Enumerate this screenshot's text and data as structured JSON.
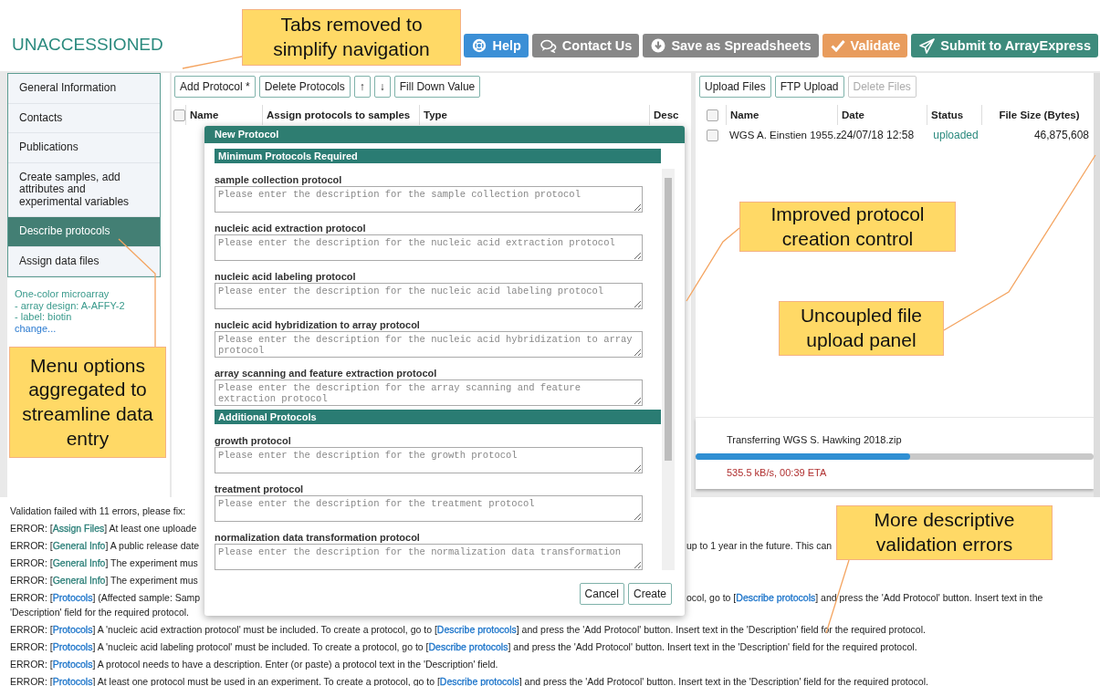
{
  "title": "UNACCESSIONED",
  "header_buttons": [
    {
      "kind": "help",
      "label": "Help"
    },
    {
      "kind": "contact",
      "label": "Contact Us"
    },
    {
      "kind": "save",
      "label": "Save as Spreadsheets"
    },
    {
      "kind": "validate",
      "label": "Validate"
    },
    {
      "kind": "submit",
      "label": "Submit to ArrayExpress"
    }
  ],
  "sidebar": {
    "items": [
      {
        "label": "General Information",
        "selected": false
      },
      {
        "label": "Contacts",
        "selected": false
      },
      {
        "label": "Publications",
        "selected": false
      },
      {
        "label": "Create samples, add attributes and experimental variables",
        "selected": false
      },
      {
        "label": "Describe protocols",
        "selected": true
      },
      {
        "label": "Assign data files",
        "selected": false
      }
    ],
    "summary": {
      "lines": [
        "One-color microarray",
        "- array design: A-AFFY-2",
        "- label: biotin"
      ],
      "link": "change..."
    }
  },
  "protocols": {
    "toolbar": [
      {
        "label": "Add Protocol *"
      },
      {
        "label": "Delete Protocols"
      },
      {
        "label": "↑"
      },
      {
        "label": "↓"
      },
      {
        "label": "Fill Down Value"
      }
    ],
    "table": {
      "header_checkbox": {
        "checked": false
      },
      "columns": [
        "Name",
        "Assign protocols to samples",
        "Type",
        "Desc"
      ]
    }
  },
  "dialog": {
    "title": "New Protocol",
    "sections": [
      {
        "title": "Minimum Protocols Required",
        "fields": [
          {
            "label": "sample collection protocol",
            "placeholder": "Please enter the description for the sample collection protocol"
          },
          {
            "label": "nucleic acid extraction protocol",
            "placeholder": "Please enter the description for the nucleic acid extraction protocol"
          },
          {
            "label": "nucleic acid labeling protocol",
            "placeholder": "Please enter the description for the nucleic acid labeling protocol"
          },
          {
            "label": "nucleic acid hybridization to array protocol",
            "placeholder": "Please enter the description for the nucleic acid hybridization to array protocol"
          },
          {
            "label": "array scanning and feature extraction protocol",
            "placeholder": "Please enter the description for the array scanning and feature extraction protocol"
          }
        ]
      },
      {
        "title": "Additional Protocols",
        "fields": [
          {
            "label": "growth protocol",
            "placeholder": "Please enter the description for the growth protocol"
          },
          {
            "label": "treatment protocol",
            "placeholder": "Please enter the description for the treatment protocol"
          },
          {
            "label": "normalization data transformation protocol",
            "placeholder": "Please enter the description for the normalization data transformation"
          }
        ]
      }
    ],
    "buttons": [
      "Cancel",
      "Create"
    ]
  },
  "files": {
    "toolbar": [
      {
        "label": "Upload Files",
        "disabled": false
      },
      {
        "label": "FTP Upload",
        "disabled": false
      },
      {
        "label": "Delete Files",
        "disabled": true
      }
    ],
    "table": {
      "header_checkbox": {
        "checked": false
      },
      "columns": [
        "Name",
        "Date",
        "Status",
        "File Size (Bytes)"
      ],
      "rows": [
        {
          "checked": false,
          "name": "WGS A. Einstien 1955.z",
          "date": "24/07/18 12:58",
          "status": "uploaded",
          "size": "46,875,608"
        }
      ]
    },
    "transfer": {
      "label": "Transferring WGS S. Hawking 2018.zip",
      "level": 0.54,
      "rate": "535.5 kB/s, 00:39 ETA"
    }
  },
  "validation": {
    "summary": "Validation failed with 11 errors, please fix:",
    "errors": [
      {
        "segments": [
          {
            "kind": "text",
            "text": "ERROR: ["
          },
          {
            "kind": "link",
            "text": "Assign Files",
            "color": "#2b7f78"
          },
          {
            "kind": "text",
            "text": "] At least one uploade"
          }
        ]
      },
      {
        "segments": [
          {
            "kind": "text",
            "text": "ERROR: ["
          },
          {
            "kind": "link",
            "text": "General Info",
            "color": "#2b7f78"
          },
          {
            "kind": "text",
            "text": "] A public release date"
          }
        ],
        "right_segments": [
          {
            "kind": "text",
            "text": "up to 1 year in the future. This can"
          }
        ]
      },
      {
        "segments": [
          {
            "kind": "text",
            "text": "ERROR: ["
          },
          {
            "kind": "link",
            "text": "General Info",
            "color": "#2b7f78"
          },
          {
            "kind": "text",
            "text": "] The experiment mus"
          }
        ]
      },
      {
        "segments": [
          {
            "kind": "text",
            "text": "ERROR: ["
          },
          {
            "kind": "link",
            "text": "General Info",
            "color": "#2b7f78"
          },
          {
            "kind": "text",
            "text": "] The experiment mus"
          }
        ]
      },
      {
        "segments": [
          {
            "kind": "text",
            "text": "ERROR: ["
          },
          {
            "kind": "link",
            "text": "Protocols",
            "color": "#1a73c9"
          },
          {
            "kind": "text",
            "text": "] (Affected sample: Samp"
          }
        ],
        "right_segments": [
          {
            "kind": "text",
            "text": "ocol, go to ["
          },
          {
            "kind": "link",
            "text": "Describe protocols",
            "color": "#1a73c9"
          },
          {
            "kind": "text",
            "text": "] and press the 'Add Protocol' button. Insert text in the"
          }
        ],
        "continuation": "'Description' field for the required protocol."
      },
      {
        "segments": [
          {
            "kind": "text",
            "text": "ERROR: ["
          },
          {
            "kind": "link",
            "text": "Protocols",
            "color": "#1a73c9"
          },
          {
            "kind": "text",
            "text": "] A 'nucleic acid extraction protocol' must be included. To create a protocol, go to ["
          },
          {
            "kind": "link",
            "text": "Describe protocols",
            "color": "#1a73c9"
          },
          {
            "kind": "text",
            "text": "] and press the 'Add Protocol' button. Insert text in the 'Description' field for the required protocol."
          }
        ]
      },
      {
        "segments": [
          {
            "kind": "text",
            "text": "ERROR: ["
          },
          {
            "kind": "link",
            "text": "Protocols",
            "color": "#1a73c9"
          },
          {
            "kind": "text",
            "text": "] A 'nucleic acid labeling protocol' must be included. To create a protocol, go to ["
          },
          {
            "kind": "link",
            "text": "Describe protocols",
            "color": "#1a73c9"
          },
          {
            "kind": "text",
            "text": "] and press the 'Add Protocol' button. Insert text in the 'Description' field for the required protocol."
          }
        ]
      },
      {
        "segments": [
          {
            "kind": "text",
            "text": "ERROR: ["
          },
          {
            "kind": "link",
            "text": "Protocols",
            "color": "#1a73c9"
          },
          {
            "kind": "text",
            "text": "] A protocol needs to have a description. Enter (or paste) a protocol text in the 'Description' field."
          }
        ]
      },
      {
        "segments": [
          {
            "kind": "text",
            "text": "ERROR: ["
          },
          {
            "kind": "link",
            "text": "Protocols",
            "color": "#1a73c9"
          },
          {
            "kind": "text",
            "text": "] At least one protocol must be used in an experiment. To create a protocol, go to ["
          },
          {
            "kind": "link",
            "text": "Describe protocols",
            "color": "#1a73c9"
          },
          {
            "kind": "text",
            "text": "] and press the 'Add Protocol' button. Insert text in the 'Description' field for the required protocol."
          }
        ]
      }
    ]
  },
  "annotations": [
    "Tabs removed to simplify navigation",
    "Menu options aggregated to streamline data entry",
    "Improved protocol creation control",
    "Uncoupled file upload panel",
    "More descriptive validation errors"
  ]
}
